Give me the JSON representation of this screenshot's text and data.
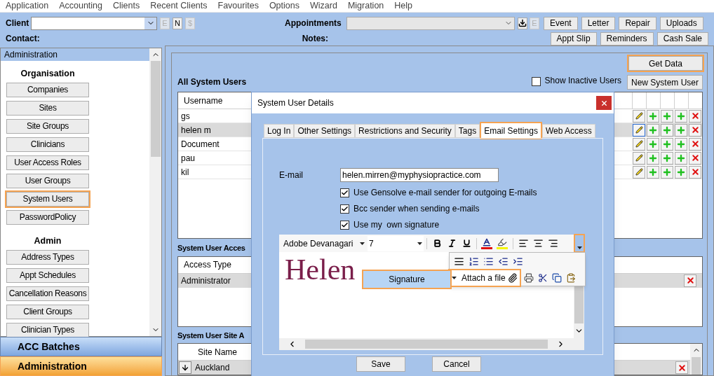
{
  "menu": [
    "Application",
    "Accounting",
    "Clients",
    "Recent Clients",
    "Favourites",
    "Options",
    "Wizard",
    "Migration",
    "Help"
  ],
  "client_bar": {
    "client_label": "Client",
    "small_buttons": [
      {
        "label": "E",
        "disabled": true
      },
      {
        "label": "N",
        "disabled": false
      },
      {
        "label": "$",
        "disabled": true
      }
    ],
    "contact_label": "Contact:",
    "appointments_label": "Appointments",
    "appt_small_buttons": [
      {
        "label": "E",
        "disabled": true
      }
    ],
    "notes_label": "Notes:",
    "buttons_row1": [
      "Event",
      "Letter",
      "Repair",
      "Uploads"
    ],
    "buttons_row2": [
      "Appt Slip",
      "Reminders",
      "Cash Sale"
    ]
  },
  "sidebar": {
    "header": "Administration",
    "sections": [
      {
        "title": "Organisation",
        "items": [
          {
            "label": "Companies",
            "highlighted": false
          },
          {
            "label": "Sites",
            "highlighted": false
          },
          {
            "label": "Site Groups",
            "highlighted": false
          },
          {
            "label": "Clinicians",
            "highlighted": false
          },
          {
            "label": "User Access Roles",
            "highlighted": false
          },
          {
            "label": "User Groups",
            "highlighted": false
          },
          {
            "label": "System Users",
            "highlighted": true
          },
          {
            "label": "PasswordPolicy",
            "highlighted": false
          }
        ]
      },
      {
        "title": "Admin",
        "items": [
          {
            "label": "Address Types",
            "highlighted": false
          },
          {
            "label": "Appt Schedules",
            "highlighted": false
          },
          {
            "label": "Cancellation Reasons",
            "highlighted": false
          },
          {
            "label": "Client Groups",
            "highlighted": false
          },
          {
            "label": "Clinician Types",
            "highlighted": false
          }
        ]
      }
    ],
    "bottom_tabs": [
      {
        "label": "ACC Batches",
        "selected": false
      },
      {
        "label": "Administration",
        "selected": true
      }
    ]
  },
  "main": {
    "get_data": {
      "label": "Get Data",
      "highlighted": true
    },
    "show_inactive": {
      "label": "Show Inactive Users",
      "checked": false
    },
    "new_user": "New System User",
    "users": {
      "title": "All System Users",
      "column_1": "Username",
      "rows": [
        {
          "username": "gs",
          "selected": false
        },
        {
          "username": "helen m",
          "selected": true
        },
        {
          "username": "Document",
          "selected": false
        },
        {
          "username": "pau",
          "selected": false
        },
        {
          "username": "kil",
          "selected": false
        }
      ]
    },
    "access": {
      "title": "System User Acces",
      "column_1": "Access Type",
      "rows": [
        {
          "access_type": "Administrator",
          "selected": true
        }
      ]
    },
    "sites": {
      "title": "System User Site A",
      "column_1": "Site Name",
      "rows": [
        {
          "site": "Auckland",
          "selected": true
        }
      ]
    }
  },
  "dialog": {
    "title": "System User Details",
    "tabs": [
      {
        "label": "Log In",
        "selected": false
      },
      {
        "label": "Other Settings",
        "selected": false
      },
      {
        "label": "Restrictions and Security",
        "selected": false
      },
      {
        "label": "Tags",
        "selected": false
      },
      {
        "label": "Email Settings",
        "selected": true
      },
      {
        "label": "Web Access",
        "selected": false
      }
    ],
    "email_label": "E-mail",
    "email": "helen.mirren@myphysiopractice.com",
    "options": [
      {
        "label": "Use Gensolve e-mail sender for outgoing E-mails",
        "checked": true
      },
      {
        "label": "Bcc sender when sending e-mails",
        "checked": true
      },
      {
        "label": "Use my  own signature",
        "checked": true
      }
    ],
    "editor": {
      "font": "Adobe Devanagari",
      "size": "7",
      "content": "Helen"
    },
    "attach": "Attach a file",
    "signature": "Signature",
    "buttons": [
      "Save",
      "Cancel"
    ]
  }
}
